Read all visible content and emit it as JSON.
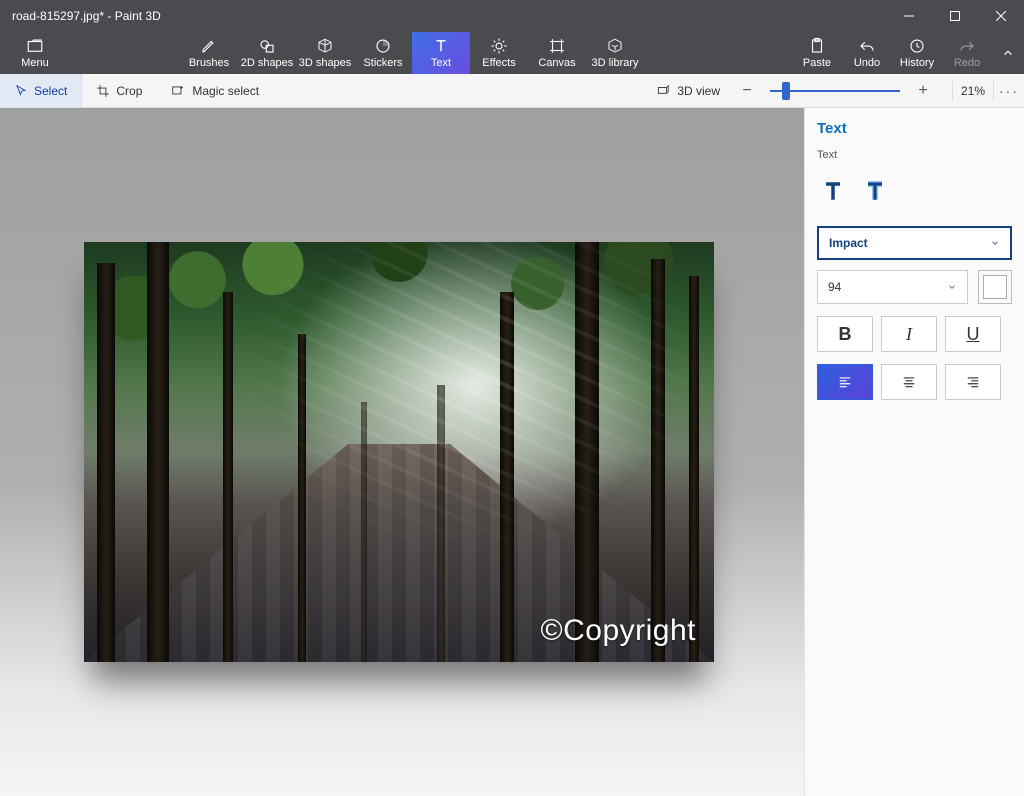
{
  "titlebar": {
    "title": "road-815297.jpg* - Paint 3D"
  },
  "menu": {
    "label": "Menu"
  },
  "tools": [
    {
      "id": "brushes",
      "label": "Brushes"
    },
    {
      "id": "2dshapes",
      "label": "2D shapes"
    },
    {
      "id": "3dshapes",
      "label": "3D shapes"
    },
    {
      "id": "stickers",
      "label": "Stickers"
    },
    {
      "id": "text",
      "label": "Text",
      "active": true
    },
    {
      "id": "effects",
      "label": "Effects"
    },
    {
      "id": "canvas",
      "label": "Canvas"
    },
    {
      "id": "3dlibrary",
      "label": "3D library"
    }
  ],
  "right_tools": {
    "paste": "Paste",
    "undo": "Undo",
    "history": "History",
    "redo": "Redo"
  },
  "subbar": {
    "select": "Select",
    "crop": "Crop",
    "magic": "Magic select",
    "view3d": "3D view",
    "zoom_pct": "21%"
  },
  "panel": {
    "title": "Text",
    "subtitle": "Text",
    "font": "Impact",
    "size": "94",
    "color": "#ffffff",
    "bold": "B",
    "italic": "I",
    "underline": "U"
  },
  "canvas": {
    "watermark": "©Copyright"
  }
}
